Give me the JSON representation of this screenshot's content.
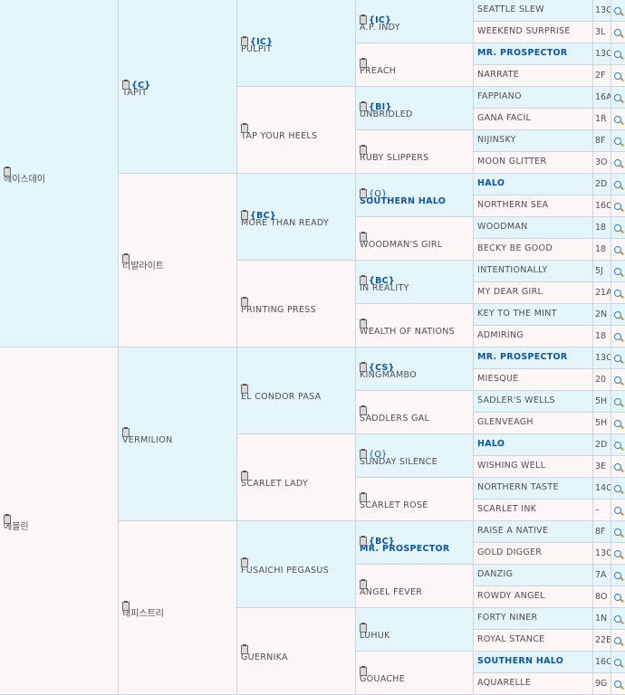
{
  "gen1": [
    {
      "name": "헤이스데이",
      "sex": "m"
    },
    {
      "name": "에블린",
      "sex": "f"
    }
  ],
  "gen2": [
    {
      "name": "TAPIT",
      "tag": "{C}",
      "sex": "m"
    },
    {
      "name": "리발라이트",
      "sex": "f"
    },
    {
      "name": "VERMILION",
      "sex": "m"
    },
    {
      "name": "태피스트리",
      "sex": "f"
    }
  ],
  "gen3": [
    {
      "name": "PULPIT",
      "tag": "{IC}",
      "sex": "m"
    },
    {
      "name": "TAP YOUR HEELS",
      "sex": "f"
    },
    {
      "name": "MORE THAN READY",
      "tag": "{BC}",
      "sex": "m"
    },
    {
      "name": "PRINTING PRESS",
      "sex": "f"
    },
    {
      "name": "EL CONDOR PASA",
      "sex": "m"
    },
    {
      "name": "SCARLET LADY",
      "sex": "f"
    },
    {
      "name": "FUSAICHI PEGASUS",
      "sex": "m"
    },
    {
      "name": "GUERNIKA",
      "sex": "f"
    }
  ],
  "gen4": [
    {
      "name": "A.P. INDY",
      "tag": "{IC}",
      "sex": "m"
    },
    {
      "name": "PREACH",
      "sex": "f"
    },
    {
      "name": "UNBRIDLED",
      "tag": "{BI}",
      "sex": "m"
    },
    {
      "name": "RUBY SLIPPERS",
      "sex": "f"
    },
    {
      "name": "SOUTHERN HALO",
      "tag": "{Q}",
      "tag_plain": true,
      "link": true,
      "sex": "m"
    },
    {
      "name": "WOODMAN'S GIRL",
      "sex": "f"
    },
    {
      "name": "IN REALITY",
      "tag": "{BC}",
      "sex": "m"
    },
    {
      "name": "WEALTH OF NATIONS",
      "sex": "f"
    },
    {
      "name": "KINGMAMBO",
      "tag": "{CS}",
      "sex": "m"
    },
    {
      "name": "SADDLERS GAL",
      "sex": "f"
    },
    {
      "name": "SUNDAY SILENCE",
      "tag": "{Q}",
      "tag_plain": true,
      "sex": "m"
    },
    {
      "name": "SCARLET ROSE",
      "sex": "f"
    },
    {
      "name": "MR. PROSPECTOR",
      "tag": "{BC}",
      "link": true,
      "sex": "m"
    },
    {
      "name": "ANGEL FEVER",
      "sex": "f"
    },
    {
      "name": "LUHUK",
      "sex": "m"
    },
    {
      "name": "GOUACHE",
      "sex": "f"
    }
  ],
  "gen5": [
    {
      "name": "SEATTLE SLEW",
      "year": "13C",
      "sex": "m"
    },
    {
      "name": "WEEKEND SURPRISE",
      "year": "3L",
      "sex": "f"
    },
    {
      "name": "MR. PROSPECTOR",
      "year": "13C",
      "link": true,
      "sex": "m"
    },
    {
      "name": "NARRATE",
      "year": "2F",
      "sex": "f"
    },
    {
      "name": "FAPPIANO",
      "year": "16A",
      "sex": "m"
    },
    {
      "name": "GANA FACIL",
      "year": "1R",
      "sex": "f"
    },
    {
      "name": "NIJINSKY",
      "year": "8F",
      "sex": "m"
    },
    {
      "name": "MOON GLITTER",
      "year": "3O",
      "sex": "f"
    },
    {
      "name": "HALO",
      "year": "2D",
      "link": true,
      "sex": "m"
    },
    {
      "name": "NORTHERN SEA",
      "year": "16C",
      "sex": "f"
    },
    {
      "name": "WOODMAN",
      "year": "18",
      "sex": "m"
    },
    {
      "name": "BECKY BE GOOD",
      "year": "18",
      "sex": "f"
    },
    {
      "name": "INTENTIONALLY",
      "year": "5J",
      "sex": "m"
    },
    {
      "name": "MY DEAR GIRL",
      "year": "21A",
      "sex": "f"
    },
    {
      "name": "KEY TO THE MINT",
      "year": "2N",
      "sex": "m"
    },
    {
      "name": "ADMIRING",
      "year": "18",
      "sex": "f"
    },
    {
      "name": "MR. PROSPECTOR",
      "year": "13C",
      "link": true,
      "sex": "m"
    },
    {
      "name": "MIESQUE",
      "year": "20",
      "sex": "f"
    },
    {
      "name": "SADLER'S WELLS",
      "year": "5H",
      "sex": "m"
    },
    {
      "name": "GLENVEAGH",
      "year": "5H",
      "sex": "f"
    },
    {
      "name": "HALO",
      "year": "2D",
      "link": true,
      "sex": "m"
    },
    {
      "name": "WISHING WELL",
      "year": "3E",
      "sex": "f"
    },
    {
      "name": "NORTHERN TASTE",
      "year": "14C",
      "sex": "m"
    },
    {
      "name": "SCARLET INK",
      "year": "–",
      "sex": "f"
    },
    {
      "name": "RAISE A NATIVE",
      "year": "8F",
      "sex": "m"
    },
    {
      "name": "GOLD DIGGER",
      "year": "13C",
      "sex": "f"
    },
    {
      "name": "DANZIG",
      "year": "7A",
      "sex": "m"
    },
    {
      "name": "ROWDY ANGEL",
      "year": "8O",
      "sex": "f"
    },
    {
      "name": "FORTY NINER",
      "year": "1N",
      "sex": "m"
    },
    {
      "name": "ROYAL STANCE",
      "year": "22E",
      "sex": "f"
    },
    {
      "name": "SOUTHERN HALO",
      "year": "16C",
      "link": true,
      "sex": "m"
    },
    {
      "name": "AQUARELLE",
      "year": "9G",
      "sex": "f"
    }
  ]
}
